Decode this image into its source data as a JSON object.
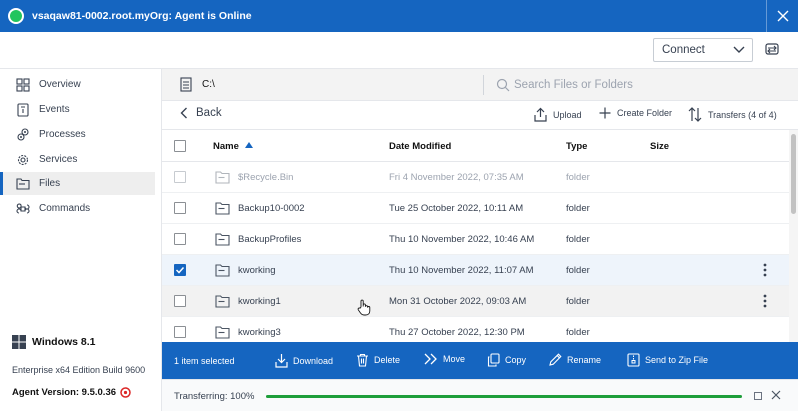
{
  "window": {
    "title": "vsaqaw81-0002.root.myOrg: Agent is Online",
    "status_color": "#22c55e"
  },
  "toolbar": {
    "connect_label": "Connect"
  },
  "sidebar": {
    "items": [
      {
        "label": "Overview",
        "icon": "grid-icon"
      },
      {
        "label": "Events",
        "icon": "event-icon"
      },
      {
        "label": "Processes",
        "icon": "gears-icon"
      },
      {
        "label": "Services",
        "icon": "gear-icon"
      },
      {
        "label": "Files",
        "icon": "folder-icon",
        "active": true
      },
      {
        "label": "Commands",
        "icon": "command-icon"
      }
    ],
    "os_name": "Windows 8.1",
    "os_build": "Enterprise x64 Edition Build 9600",
    "agent_version": "Agent Version: 9.5.0.36"
  },
  "pathbar": {
    "path": "C:\\",
    "search_placeholder": "Search Files or Folders"
  },
  "actions": {
    "back": "Back",
    "upload": "Upload",
    "create_folder": "Create Folder",
    "transfers": "Transfers (4 of 4)"
  },
  "table": {
    "columns": {
      "name": "Name",
      "date": "Date Modified",
      "type": "Type",
      "size": "Size"
    },
    "rows": [
      {
        "name": "$Recycle.Bin",
        "date": "Fri 4 November 2022, 07:35 AM",
        "type": "folder",
        "checked": false,
        "dim": true
      },
      {
        "name": "Backup10-0002",
        "date": "Tue 25 October 2022, 10:11 AM",
        "type": "folder",
        "checked": false
      },
      {
        "name": "BackupProfiles",
        "date": "Thu 10 November 2022, 10:46 AM",
        "type": "folder",
        "checked": false
      },
      {
        "name": "kworking",
        "date": "Thu 10 November 2022, 11:07 AM",
        "type": "folder",
        "checked": true
      },
      {
        "name": "kworking1",
        "date": "Mon 31 October 2022, 09:03 AM",
        "type": "folder",
        "checked": false
      },
      {
        "name": "kworking3",
        "date": "Thu 27 October 2022, 12:30 PM",
        "type": "folder",
        "checked": false
      }
    ]
  },
  "selection_bar": {
    "count": "1 item selected",
    "download": "Download",
    "delete": "Delete",
    "move": "Move",
    "copy": "Copy",
    "rename": "Rename",
    "zip": "Send to Zip File"
  },
  "transfer": {
    "label": "Transferring: 100%",
    "progress": 1.0,
    "color": "#1e9e3a"
  }
}
